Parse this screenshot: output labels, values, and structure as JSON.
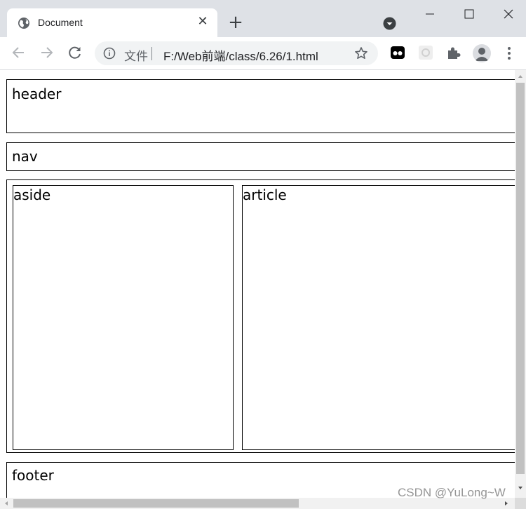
{
  "browser": {
    "tab": {
      "title": "Document"
    },
    "address_bar": {
      "scheme_label": "文件",
      "url": "F:/Web前端/class/6.26/1.html"
    }
  },
  "page": {
    "header": {
      "label": "header"
    },
    "nav": {
      "label": "nav"
    },
    "aside": {
      "label": "aside"
    },
    "article": {
      "label": "article"
    },
    "footer": {
      "label": "footer"
    }
  },
  "watermark": "CSDN @YuLong~W",
  "icons": {
    "favicon": "globe-icon",
    "tab_close": "close-icon",
    "new_tab": "plus-icon",
    "tab_search": "chevron-down-circle-icon",
    "back": "arrow-left-icon",
    "forward": "arrow-right-icon",
    "reload": "reload-icon",
    "site_info": "info-icon",
    "bookmark": "star-icon",
    "extensions": "puzzle-icon",
    "profile": "avatar-icon",
    "menu": "kebab-menu-icon"
  }
}
